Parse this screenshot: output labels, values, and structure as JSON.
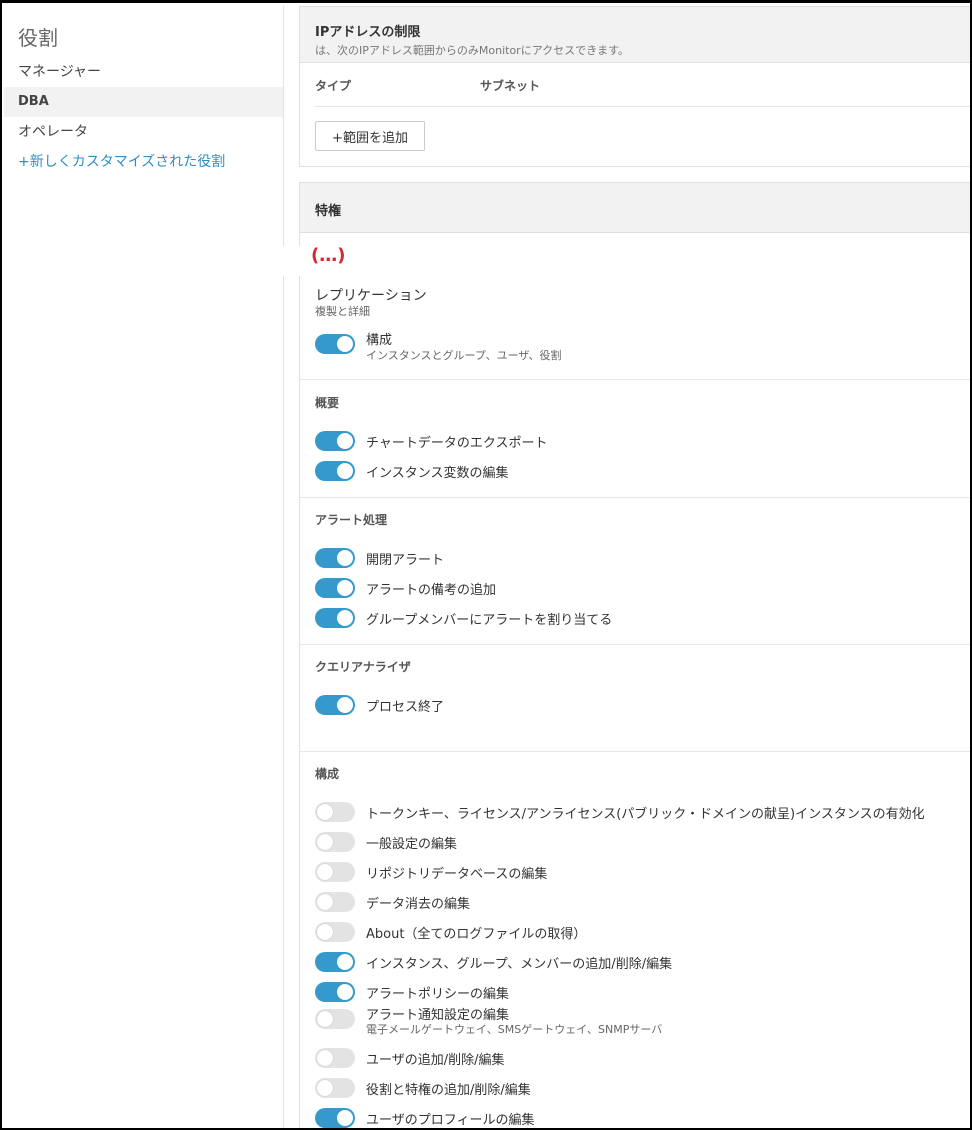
{
  "sidebar": {
    "title": "役割",
    "roles": [
      {
        "label": "マネージャー",
        "selected": false
      },
      {
        "label": "DBA",
        "selected": true
      },
      {
        "label": "オペレータ",
        "selected": false
      }
    ],
    "add_role": "+新しくカスタマイズされた役割"
  },
  "ip_restriction": {
    "title": "IPアドレスの制限",
    "subtitle": "は、次のIPアドレス範囲からのみMonitorにアクセスできます。",
    "col_type": "タイプ",
    "col_subnet": "サブネット",
    "add_range": "+範囲を追加"
  },
  "privileges": {
    "title": "特権",
    "ellipsis": "(…)",
    "replication": {
      "title": "レプリケーション",
      "subtitle": "複製と詳細"
    },
    "config_toggle": {
      "label": "構成",
      "sub": "インスタンスとグループ、ユーザ、役割",
      "on": true
    },
    "overview": {
      "title": "概要",
      "items": [
        {
          "label": "チャートデータのエクスポート",
          "on": true
        },
        {
          "label": "インスタンス変数の編集",
          "on": true
        }
      ]
    },
    "alerts": {
      "title": "アラート処理",
      "items": [
        {
          "label": "開閉アラート",
          "on": true
        },
        {
          "label": "アラートの備考の追加",
          "on": true
        },
        {
          "label": "グループメンバーにアラートを割り当てる",
          "on": true
        }
      ]
    },
    "query": {
      "title": "クエリアナライザ",
      "items": [
        {
          "label": "プロセス終了",
          "on": true
        }
      ]
    },
    "configuration": {
      "title": "構成",
      "items": [
        {
          "label": "トークンキー、ライセンス/アンライセンス(パブリック・ドメインの献呈)インスタンスの有効化",
          "on": false
        },
        {
          "label": "一般設定の編集",
          "on": false
        },
        {
          "label": "リポジトリデータベースの編集",
          "on": false
        },
        {
          "label": "データ消去の編集",
          "on": false
        },
        {
          "label": "About（全てのログファイルの取得）",
          "on": false
        },
        {
          "label": "インスタンス、グループ、メンバーの追加/削除/編集",
          "on": true
        },
        {
          "label": "アラートポリシーの編集",
          "on": true
        },
        {
          "label": "アラート通知設定の編集",
          "sub": "電子メールゲートウェイ、SMSゲートウェイ、SNMPサーバ",
          "on": false
        },
        {
          "label": "ユーザの追加/削除/編集",
          "on": false
        },
        {
          "label": "役割と特権の追加/削除/編集",
          "on": false
        },
        {
          "label": "ユーザのプロフィールの編集",
          "on": true
        }
      ]
    }
  },
  "colors": {
    "accent": "#3699cb",
    "link": "#2e8ec0",
    "ellipsis": "#d9262c"
  }
}
